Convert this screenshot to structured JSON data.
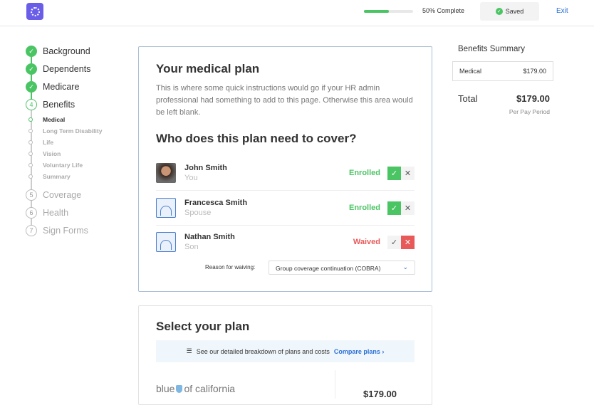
{
  "header": {
    "progress_percent": 50,
    "progress_label": "50% Complete",
    "saved_label": "Saved",
    "exit_label": "Exit",
    "logo_icon": "brand-logo"
  },
  "steps": [
    {
      "num": "1",
      "label": "Background",
      "state": "done"
    },
    {
      "num": "2",
      "label": "Dependents",
      "state": "done"
    },
    {
      "num": "3",
      "label": "Medicare",
      "state": "done"
    },
    {
      "num": "4",
      "label": "Benefits",
      "state": "current"
    },
    {
      "num": "5",
      "label": "Coverage",
      "state": "todo"
    },
    {
      "num": "6",
      "label": "Health",
      "state": "todo"
    },
    {
      "num": "7",
      "label": "Sign Forms",
      "state": "todo"
    }
  ],
  "substeps": [
    "Medical",
    "Long Term Disability",
    "Life",
    "Vision",
    "Voluntary Life",
    "Summary"
  ],
  "medical": {
    "title": "Your medical plan",
    "instructions": "This is where some quick instructions would go if your HR admin professional had something to add to this page. Otherwise this area would be left blank.",
    "cover_title": "Who does this plan need to cover?",
    "people": [
      {
        "name": "John Smith",
        "relation": "You",
        "status": "Enrolled"
      },
      {
        "name": "Francesca Smith",
        "relation": "Spouse",
        "status": "Enrolled"
      },
      {
        "name": "Nathan Smith",
        "relation": "Son",
        "status": "Waived"
      }
    ],
    "reason_label": "Reason for waiving:",
    "reason_value": "Group coverage continuation (COBRA)"
  },
  "plan": {
    "title": "Select your plan",
    "banner_text": "See our detailed breakdown of plans and costs",
    "compare_link": "Compare plans",
    "provider_left": "blue",
    "provider_right": "of california",
    "price": "$179.00"
  },
  "summary": {
    "title": "Benefits Summary",
    "item_label": "Medical",
    "item_price": "$179.00",
    "total_label": "Total",
    "total_price": "$179.00",
    "period": "Per Pay Period"
  },
  "colors": {
    "accent": "#2b6fd6",
    "success": "#4bc464",
    "danger": "#e85a5a",
    "brand": "#6a5de8"
  }
}
